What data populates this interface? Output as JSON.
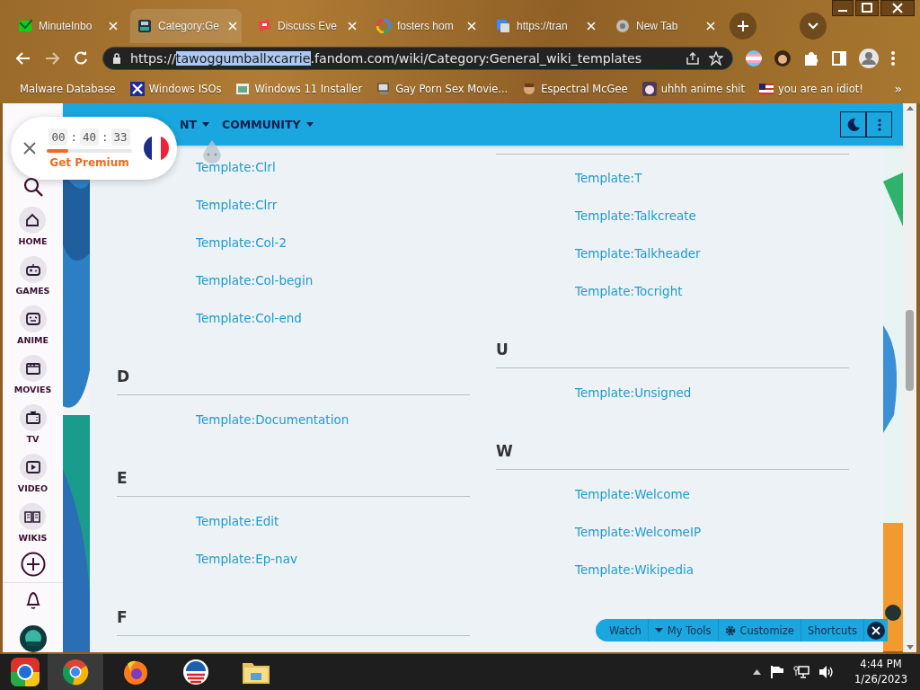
{
  "browser": {
    "tabs": [
      {
        "title": "MinuteInbo",
        "selected": false
      },
      {
        "title": "Category:Ge",
        "selected": true
      },
      {
        "title": "Discuss Eve",
        "selected": false
      },
      {
        "title": "fosters hom",
        "selected": false
      },
      {
        "title": "https://tran",
        "selected": false
      },
      {
        "title": "New Tab",
        "selected": false
      }
    ],
    "address": [
      {
        "text": "https://",
        "selected": false
      },
      {
        "text": "tawoggumballxcarrie",
        "selected": true
      },
      {
        "text": ".fandom.com/wiki/Category:General_wiki_templates",
        "selected": false
      }
    ],
    "bookmarks": [
      {
        "label": "Malware Database"
      },
      {
        "label": "Windows ISOs"
      },
      {
        "label": "Windows 11 Installer"
      },
      {
        "label": "Gay Porn Sex Movie..."
      },
      {
        "label": "Espectral McGee"
      },
      {
        "label": "uhhh anime shit"
      },
      {
        "label": "you are an idiot!"
      }
    ],
    "bookmarks_overflow": "»"
  },
  "timer": {
    "segments": [
      "00",
      "40",
      "33"
    ],
    "separators": [
      ":",
      ":"
    ],
    "level": 0.25,
    "cta": "Get Premium"
  },
  "wiki": {
    "nav": [
      {
        "label": "NT"
      },
      {
        "label": "COMMUNITY"
      }
    ],
    "sidebar": [
      {
        "label": "HOME",
        "kind": "home"
      },
      {
        "label": "GAMES",
        "kind": "games"
      },
      {
        "label": "ANIME",
        "kind": "anime"
      },
      {
        "label": "MOVIES",
        "kind": "movies"
      },
      {
        "label": "TV",
        "kind": "tv"
      },
      {
        "label": "VIDEO",
        "kind": "video"
      },
      {
        "label": "WIKIS",
        "kind": "wikis"
      }
    ],
    "columns": [
      {
        "items": [
          {
            "kind": "link",
            "text": "Template:Clrl"
          },
          {
            "kind": "link",
            "text": "Template:Clrr"
          },
          {
            "kind": "link",
            "text": "Template:Col-2"
          },
          {
            "kind": "link",
            "text": "Template:Col-begin"
          },
          {
            "kind": "link",
            "text": "Template:Col-end"
          },
          {
            "kind": "heading",
            "text": "D"
          },
          {
            "kind": "link",
            "text": "Template:Documentation"
          },
          {
            "kind": "heading",
            "text": "E"
          },
          {
            "kind": "link",
            "text": "Template:Edit"
          },
          {
            "kind": "link",
            "text": "Template:Ep-nav"
          },
          {
            "kind": "heading",
            "text": "F"
          }
        ]
      },
      {
        "items": [
          {
            "kind": "link",
            "text": "Template:T"
          },
          {
            "kind": "link",
            "text": "Template:Talkcreate"
          },
          {
            "kind": "link",
            "text": "Template:Talkheader"
          },
          {
            "kind": "link",
            "text": "Template:Tocright"
          },
          {
            "kind": "heading",
            "text": "U"
          },
          {
            "kind": "link",
            "text": "Template:Unsigned"
          },
          {
            "kind": "heading",
            "text": "W"
          },
          {
            "kind": "link",
            "text": "Template:Welcome"
          },
          {
            "kind": "link",
            "text": "Template:WelcomeIP"
          },
          {
            "kind": "link",
            "text": "Template:Wikipedia"
          }
        ]
      }
    ],
    "toolbar": [
      {
        "label": "Watch",
        "kind": "plain"
      },
      {
        "label": "My Tools",
        "kind": "menu"
      },
      {
        "label": "Customize",
        "kind": "settings"
      },
      {
        "label": "Shortcuts",
        "kind": "plain"
      }
    ]
  },
  "taskbar": {
    "time": "4:44 PM",
    "date": "1/26/2023"
  }
}
